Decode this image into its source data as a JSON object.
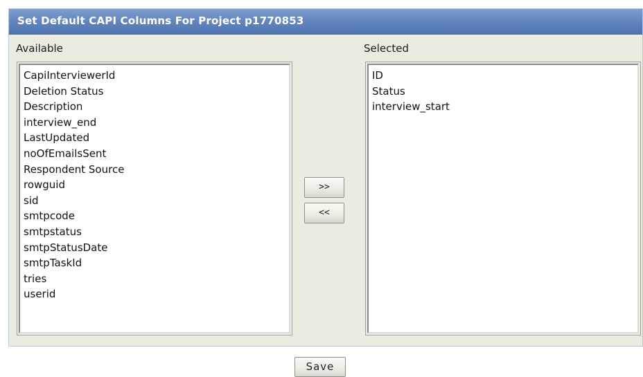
{
  "dialog": {
    "title": "Set Default CAPI Columns For Project p1770853"
  },
  "available": {
    "label": "Available",
    "items": [
      "CapiInterviewerId",
      "Deletion Status",
      "Description",
      "interview_end",
      "LastUpdated",
      "noOfEmailsSent",
      "Respondent Source",
      "rowguid",
      "sid",
      "smtpcode",
      "smtpstatus",
      "smtpStatusDate",
      "smtpTaskId",
      "tries",
      "userid"
    ]
  },
  "selected": {
    "label": "Selected",
    "items": [
      "ID",
      "Status",
      "interview_start"
    ]
  },
  "buttons": {
    "add_label": ">>",
    "remove_label": "<<",
    "save_label": "Save"
  }
}
